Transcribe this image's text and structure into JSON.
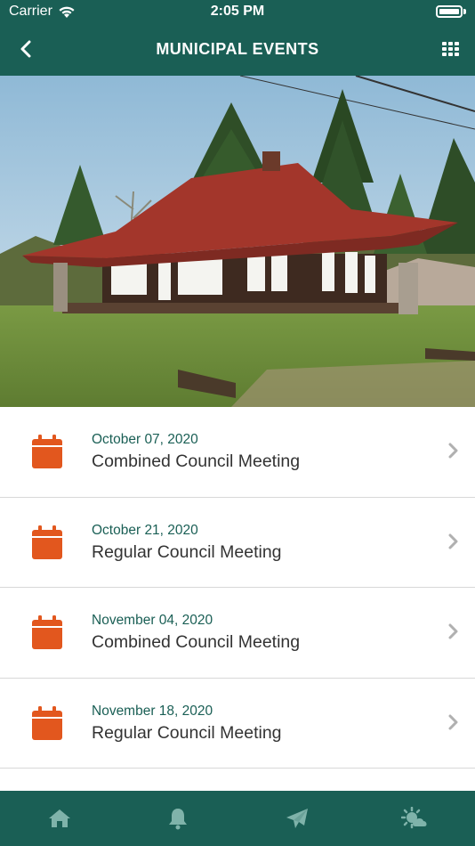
{
  "status_bar": {
    "carrier": "Carrier",
    "time": "2:05 PM"
  },
  "nav": {
    "title": "MUNICIPAL EVENTS"
  },
  "colors": {
    "brand": "#1a5f55",
    "accent": "#e2571e",
    "tab_icon": "#7fb3aa"
  },
  "events": [
    {
      "date": "October 07, 2020",
      "title": "Combined Council Meeting"
    },
    {
      "date": "October 21, 2020",
      "title": "Regular Council Meeting"
    },
    {
      "date": "November 04, 2020",
      "title": "Combined Council Meeting"
    },
    {
      "date": "November 18, 2020",
      "title": "Regular Council Meeting"
    }
  ],
  "tabs": [
    {
      "icon": "home-icon"
    },
    {
      "icon": "bell-icon"
    },
    {
      "icon": "send-icon"
    },
    {
      "icon": "weather-icon"
    }
  ]
}
